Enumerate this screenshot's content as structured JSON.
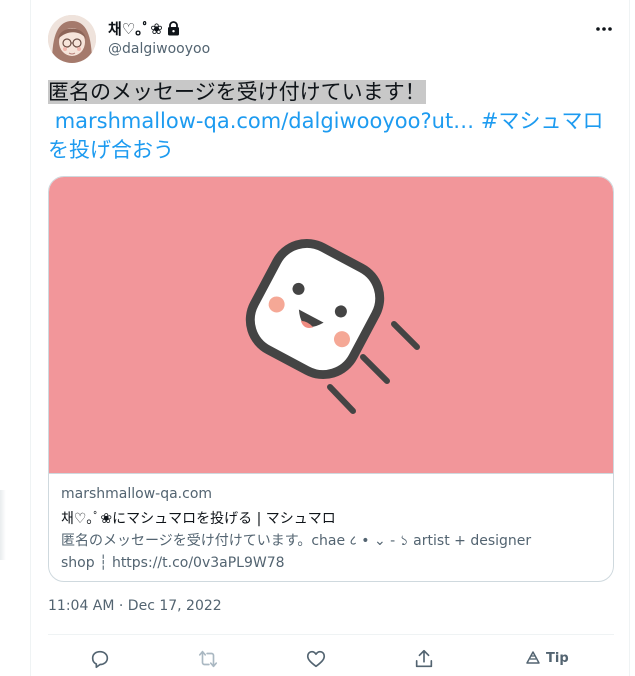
{
  "user": {
    "display_name": "채♡｡ﾟ❀",
    "handle": "@dalgiwooyoo",
    "locked": true
  },
  "tweet": {
    "text_highlighted": "匿名のメッセージを受け付けています！",
    "link_text": "marshmallow-qa.com/dalgiwooyoo?ut…",
    "hashtag": "#マシュマロを投げ合おう"
  },
  "card": {
    "domain": "marshmallow-qa.com",
    "title": "채♡｡ﾟ❀にマシュマロを投げる | マシュマロ",
    "description": "匿名のメッセージを受け付けています。chae ८ • ⌄ - ১ artist + designer shop ┆ https://t.co/0v3aPL9W78",
    "image_bg": "#f2969a"
  },
  "timestamp": "11:04 AM · Dec 17, 2022",
  "actions": {
    "reply_icon": "reply-icon",
    "retweet_icon": "retweet-icon",
    "like_icon": "heart-icon",
    "share_icon": "share-icon",
    "tip_label": "Tip"
  },
  "colors": {
    "link": "#1d9bf0",
    "secondary_text": "#536471",
    "border": "#cfd9de"
  }
}
